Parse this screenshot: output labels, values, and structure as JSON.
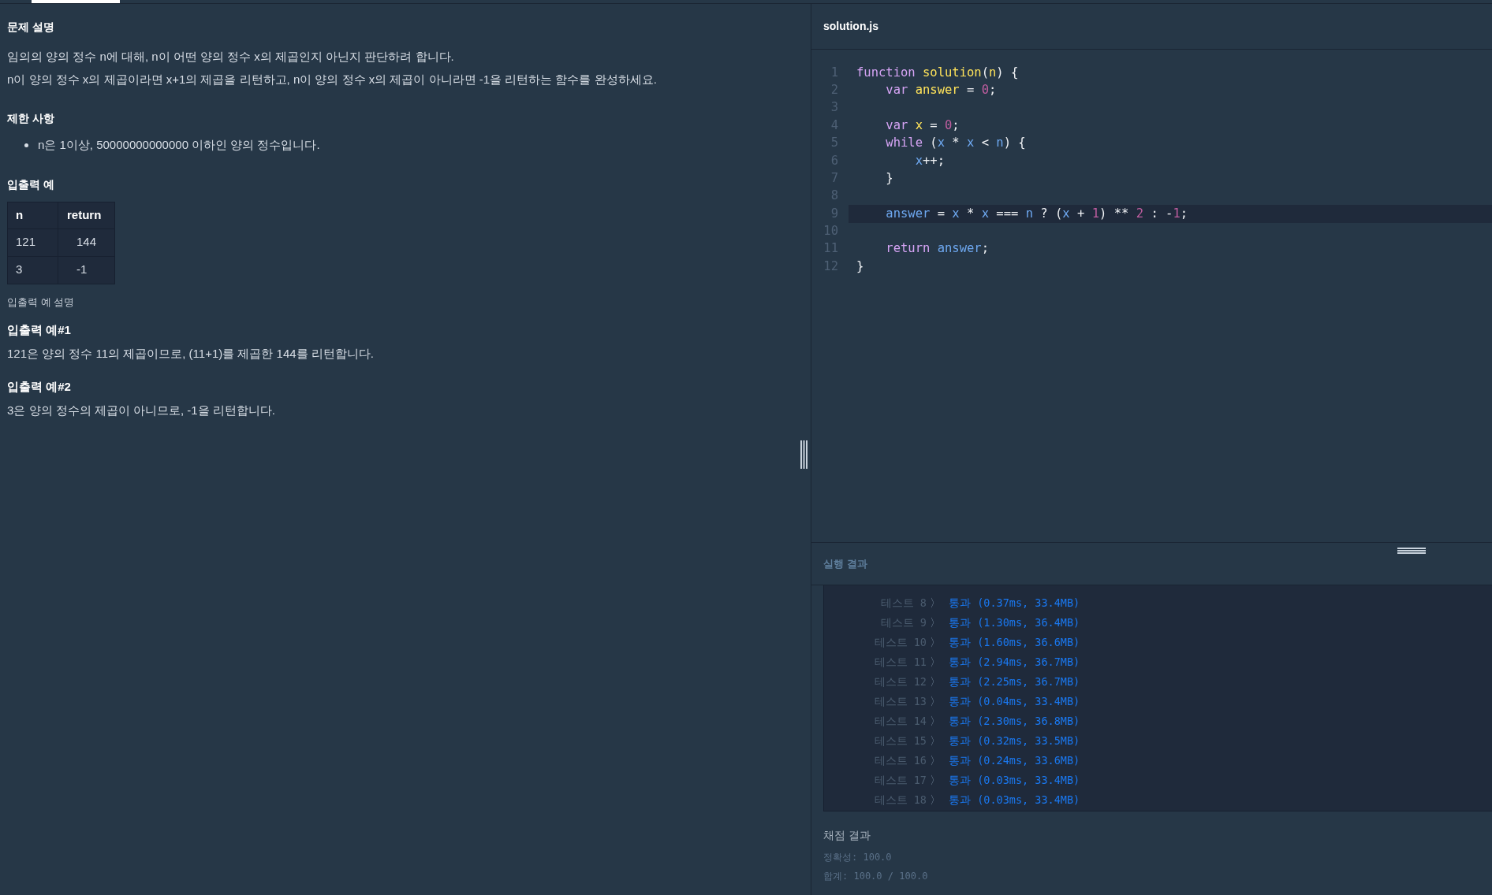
{
  "problem": {
    "title": "문제 설명",
    "description": [
      "임의의 양의 정수 n에 대해, n이 어떤 양의 정수 x의 제곱인지 아닌지 판단하려 합니다.",
      "n이 양의 정수 x의 제곱이라면 x+1의 제곱을 리턴하고, n이 양의 정수 x의 제곱이 아니라면 -1을 리턴하는 함수를 완성하세요."
    ],
    "constraints_title": "제한 사항",
    "constraints": [
      "n은 1이상, 50000000000000 이하인 양의 정수입니다."
    ],
    "examples_title": "입출력 예",
    "table": {
      "columns": [
        "n",
        "return"
      ],
      "rows": [
        [
          "121",
          "144"
        ],
        [
          "3",
          "-1"
        ]
      ]
    },
    "explanation_title": "입출력 예 설명",
    "explanations": [
      {
        "title": "입출력 예#1",
        "text": "121은 양의 정수 11의 제곱이므로, (11+1)를 제곱한 144를 리턴합니다."
      },
      {
        "title": "입출력 예#2",
        "text": "3은 양의 정수의 제곱이 아니므로, -1을 리턴합니다."
      }
    ]
  },
  "editor": {
    "filename": "solution.js",
    "lines": [
      {
        "number": "1",
        "highlighted": false,
        "tokens": [
          {
            "text": "function",
            "kind": "keyword"
          },
          {
            "text": " solution",
            "kind": "def"
          },
          {
            "text": "(",
            "kind": "plain"
          },
          {
            "text": "n",
            "kind": "def"
          },
          {
            "text": ") {",
            "kind": "plain"
          }
        ]
      },
      {
        "number": "2",
        "highlighted": false,
        "tokens": [
          {
            "text": "    var",
            "kind": "keyword"
          },
          {
            "text": " answer",
            "kind": "def"
          },
          {
            "text": " = ",
            "kind": "plain"
          },
          {
            "text": "0",
            "kind": "number"
          },
          {
            "text": ";",
            "kind": "plain"
          }
        ]
      },
      {
        "number": "3",
        "highlighted": false
      },
      {
        "number": "4",
        "highlighted": false,
        "tokens": [
          {
            "text": "    var",
            "kind": "keyword"
          },
          {
            "text": " x",
            "kind": "def"
          },
          {
            "text": " = ",
            "kind": "plain"
          },
          {
            "text": "0",
            "kind": "number"
          },
          {
            "text": ";",
            "kind": "plain"
          }
        ]
      },
      {
        "number": "5",
        "highlighted": false,
        "tokens": [
          {
            "text": "    while",
            "kind": "keyword"
          },
          {
            "text": " (",
            "kind": "plain"
          },
          {
            "text": "x",
            "kind": "variable"
          },
          {
            "text": " * ",
            "kind": "plain"
          },
          {
            "text": "x",
            "kind": "variable"
          },
          {
            "text": " < ",
            "kind": "plain"
          },
          {
            "text": "n",
            "kind": "variable"
          },
          {
            "text": ") {",
            "kind": "plain"
          }
        ]
      },
      {
        "number": "6",
        "highlighted": false,
        "tokens": [
          {
            "text": "        x",
            "kind": "variable"
          },
          {
            "text": "++;",
            "kind": "plain"
          }
        ]
      },
      {
        "number": "7",
        "highlighted": false,
        "tokens": [
          {
            "text": "    }",
            "kind": "plain"
          }
        ]
      },
      {
        "number": "8",
        "highlighted": false
      },
      {
        "number": "9",
        "highlighted": true,
        "tokens": [
          {
            "text": "    answer",
            "kind": "variable"
          },
          {
            "text": " = ",
            "kind": "plain"
          },
          {
            "text": "x",
            "kind": "variable"
          },
          {
            "text": " * ",
            "kind": "plain"
          },
          {
            "text": "x",
            "kind": "variable"
          },
          {
            "text": " === ",
            "kind": "plain"
          },
          {
            "text": "n",
            "kind": "variable"
          },
          {
            "text": " ? (",
            "kind": "plain"
          },
          {
            "text": "x",
            "kind": "variable"
          },
          {
            "text": " + ",
            "kind": "plain"
          },
          {
            "text": "1",
            "kind": "number"
          },
          {
            "text": ") ** ",
            "kind": "plain"
          },
          {
            "text": "2",
            "kind": "number"
          },
          {
            "text": " : -",
            "kind": "plain"
          },
          {
            "text": "1",
            "kind": "number"
          },
          {
            "text": ";",
            "kind": "plain"
          }
        ]
      },
      {
        "number": "10",
        "highlighted": false
      },
      {
        "number": "11",
        "highlighted": false,
        "tokens": [
          {
            "text": "    return",
            "kind": "keyword"
          },
          {
            "text": " answer",
            "kind": "variable"
          },
          {
            "text": ";",
            "kind": "plain"
          }
        ]
      },
      {
        "number": "12",
        "highlighted": false,
        "tokens": [
          {
            "text": "}",
            "kind": "plain"
          }
        ]
      }
    ]
  },
  "results": {
    "title": "실행 결과",
    "rows": [
      {
        "label": "테스트",
        "number": "8",
        "arrow": "〉",
        "result": "통과 (0.37ms, 33.4MB)"
      },
      {
        "label": "테스트",
        "number": "9",
        "arrow": "〉",
        "result": "통과 (1.30ms, 36.4MB)"
      },
      {
        "label": "테스트",
        "number": "10",
        "arrow": "〉",
        "result": "통과 (1.60ms, 36.6MB)"
      },
      {
        "label": "테스트",
        "number": "11",
        "arrow": "〉",
        "result": "통과 (2.94ms, 36.7MB)"
      },
      {
        "label": "테스트",
        "number": "12",
        "arrow": "〉",
        "result": "통과 (2.25ms, 36.7MB)"
      },
      {
        "label": "테스트",
        "number": "13",
        "arrow": "〉",
        "result": "통과 (0.04ms, 33.4MB)"
      },
      {
        "label": "테스트",
        "number": "14",
        "arrow": "〉",
        "result": "통과 (2.30ms, 36.8MB)"
      },
      {
        "label": "테스트",
        "number": "15",
        "arrow": "〉",
        "result": "통과 (0.32ms, 33.5MB)"
      },
      {
        "label": "테스트",
        "number": "16",
        "arrow": "〉",
        "result": "통과 (0.24ms, 33.6MB)"
      },
      {
        "label": "테스트",
        "number": "17",
        "arrow": "〉",
        "result": "통과 (0.03ms, 33.4MB)"
      },
      {
        "label": "테스트",
        "number": "18",
        "arrow": "〉",
        "result": "통과 (0.03ms, 33.4MB)"
      }
    ]
  },
  "grading": {
    "title": "채점 결과",
    "accuracy": "정확성: 100.0",
    "total": "합계: 100.0 / 100.0"
  }
}
